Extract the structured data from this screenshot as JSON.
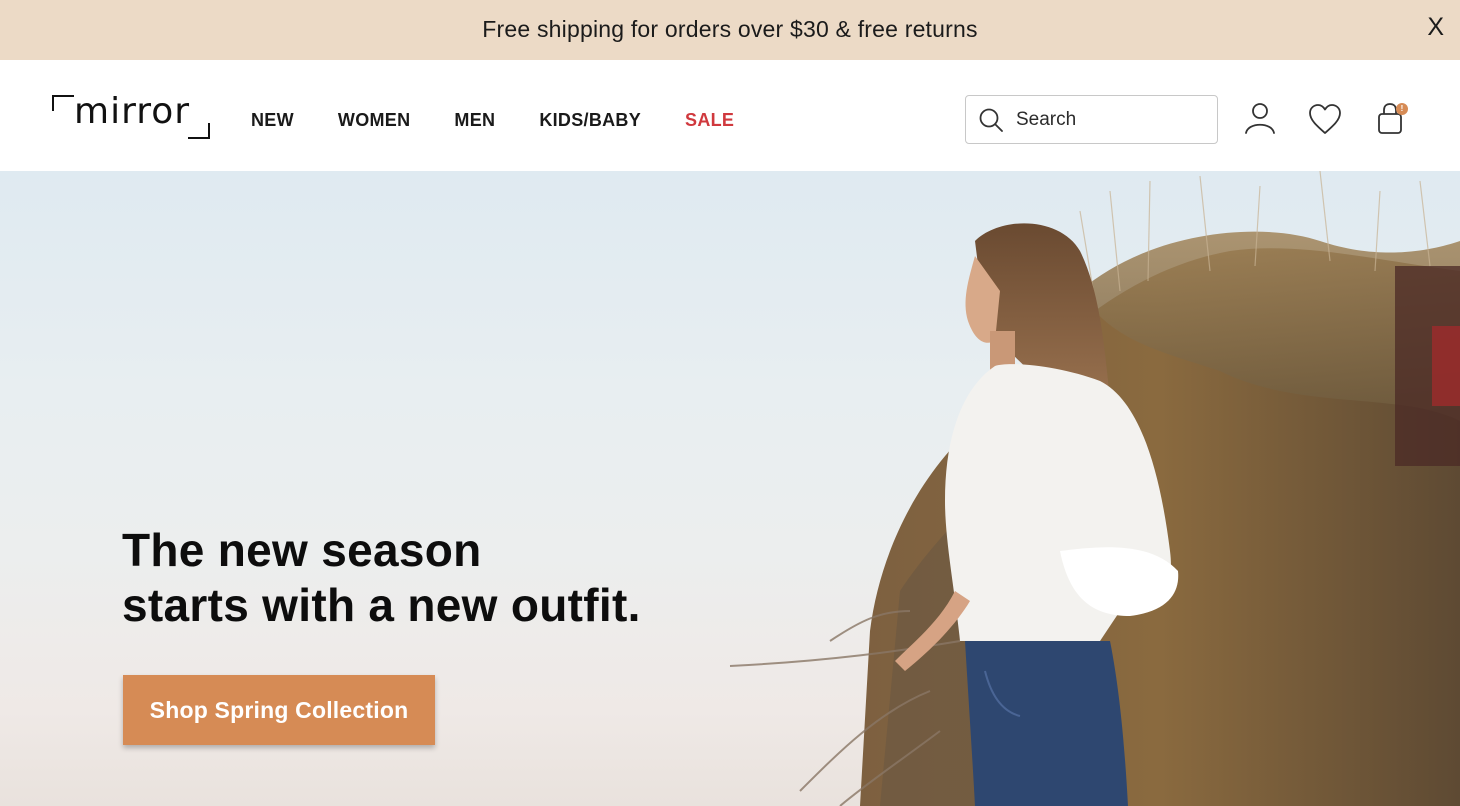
{
  "promo": {
    "message": "Free shipping  for orders over $30 & free returns",
    "close_label": "X"
  },
  "header": {
    "logo_text": "mirror",
    "nav": [
      {
        "label": "NEW"
      },
      {
        "label": "WOMEN"
      },
      {
        "label": "MEN"
      },
      {
        "label": "KIDS/BABY"
      },
      {
        "label": "SALE",
        "color": "#d0393e"
      }
    ],
    "search": {
      "placeholder": "Search",
      "value": ""
    },
    "icons": [
      "user-icon",
      "heart-icon",
      "shopping-bag-icon"
    ],
    "cart_badge": "!"
  },
  "hero": {
    "headline_line1": "The new season",
    "headline_line2": "starts with a new outfit.",
    "cta_label": "Shop Spring Collection"
  },
  "colors": {
    "promo_bg": "#ecdac6",
    "accent": "#d68b55",
    "sale": "#d0393e",
    "text": "#111111"
  }
}
